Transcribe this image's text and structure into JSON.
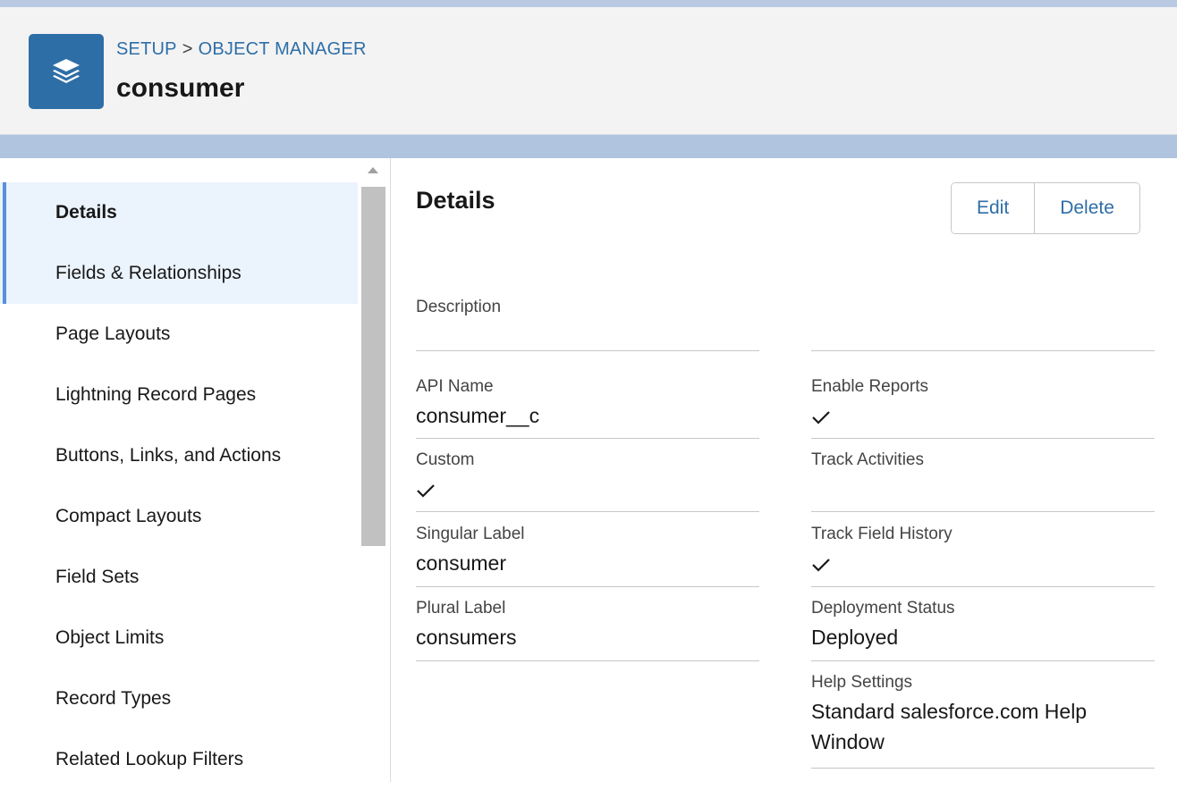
{
  "header": {
    "breadcrumb": {
      "setup": "SETUP",
      "separator": ">",
      "object_manager": "OBJECT MANAGER"
    },
    "title": "consumer",
    "icon": "layers-icon"
  },
  "sidebar": {
    "items": [
      {
        "label": "Details",
        "state": "active"
      },
      {
        "label": "Fields & Relationships",
        "state": "hover"
      },
      {
        "label": "Page Layouts"
      },
      {
        "label": "Lightning Record Pages"
      },
      {
        "label": "Buttons, Links, and Actions"
      },
      {
        "label": "Compact Layouts"
      },
      {
        "label": "Field Sets"
      },
      {
        "label": "Object Limits"
      },
      {
        "label": "Record Types"
      },
      {
        "label": "Related Lookup Filters"
      }
    ]
  },
  "main": {
    "section_title": "Details",
    "buttons": {
      "edit": "Edit",
      "delete": "Delete"
    },
    "fields": {
      "description": {
        "label": "Description",
        "value": ""
      },
      "api_name": {
        "label": "API Name",
        "value": "consumer__c"
      },
      "custom": {
        "label": "Custom",
        "checked": true
      },
      "singular_label": {
        "label": "Singular Label",
        "value": "consumer"
      },
      "plural_label": {
        "label": "Plural Label",
        "value": "consumers"
      },
      "enable_reports": {
        "label": "Enable Reports",
        "checked": true
      },
      "track_activities": {
        "label": "Track Activities",
        "checked": false
      },
      "track_field_history": {
        "label": "Track Field History",
        "checked": true
      },
      "deployment_status": {
        "label": "Deployment Status",
        "value": "Deployed"
      },
      "help_settings": {
        "label": "Help Settings",
        "value": "Standard salesforce.com Help Window"
      }
    }
  },
  "colors": {
    "brand": "#2e6ea7",
    "active_nav_bg": "#ebf3fd",
    "active_nav_bar": "#5a8fdc"
  }
}
